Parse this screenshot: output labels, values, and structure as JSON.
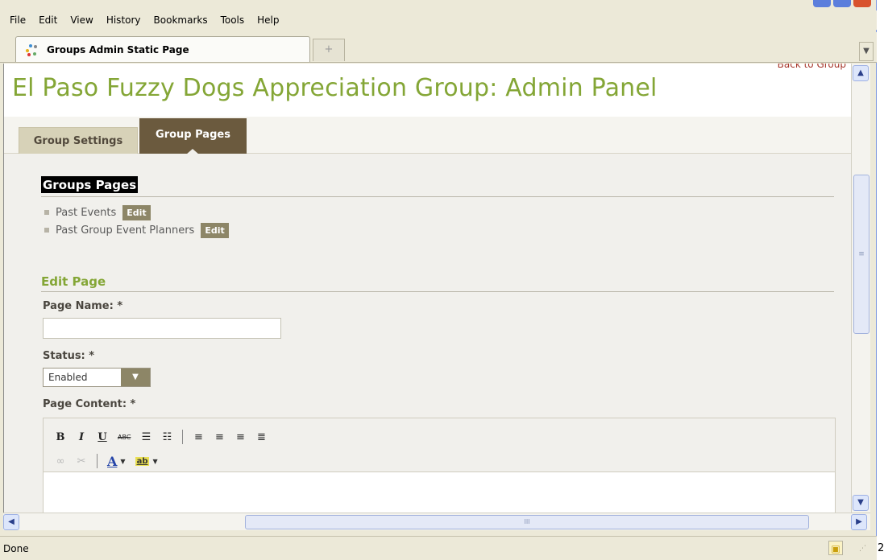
{
  "menu": [
    "File",
    "Edit",
    "View",
    "History",
    "Bookmarks",
    "Tools",
    "Help"
  ],
  "browser_tab": {
    "title": "Groups Admin Static Page",
    "new_tab_symbol": "+"
  },
  "page": {
    "back_link": "Back to Group",
    "title": "El Paso Fuzzy Dogs Appreciation Group: Admin Panel",
    "tabs": [
      {
        "label": "Group Settings",
        "active": false
      },
      {
        "label": "Group Pages",
        "active": true
      }
    ],
    "groups_pages": {
      "heading": "Groups Pages",
      "items": [
        {
          "name": "Past Events",
          "action": "Edit"
        },
        {
          "name": "Past Group Event Planners",
          "action": "Edit"
        }
      ]
    },
    "edit_page": {
      "heading": "Edit Page",
      "page_name_label": "Page Name: *",
      "page_name_value": "",
      "status_label": "Status: *",
      "status_value": "Enabled",
      "content_label": "Page Content: *"
    }
  },
  "status": {
    "text": "Done"
  },
  "edge_text": "2",
  "colors": {
    "title_green": "#84a636",
    "tab_active": "#6b5a3e",
    "edit_button": "#8d8667"
  }
}
